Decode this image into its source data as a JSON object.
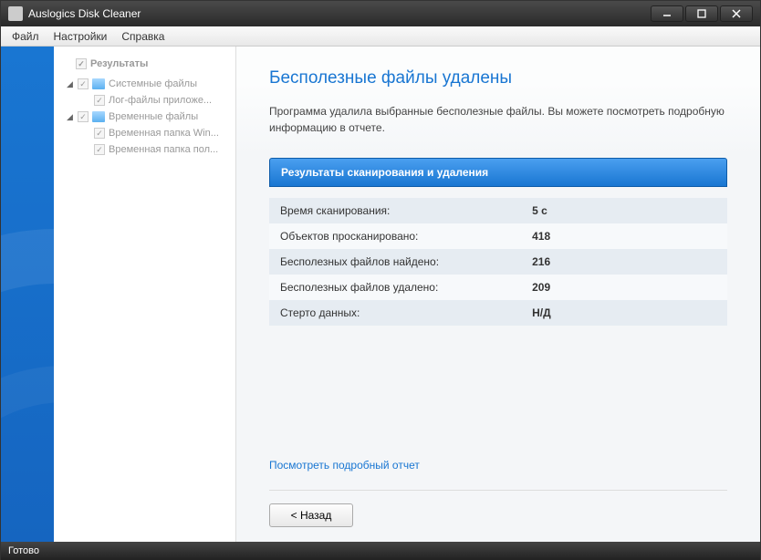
{
  "window": {
    "title": "Auslogics Disk Cleaner"
  },
  "menu": {
    "file": "Файл",
    "settings": "Настройки",
    "help": "Справка"
  },
  "tree": {
    "results": "Результаты",
    "system_files": "Системные файлы",
    "log_files": "Лог-файлы приложе...",
    "temp_files": "Временные файлы",
    "temp_win": "Временная папка Win...",
    "temp_user": "Временная папка пол..."
  },
  "content": {
    "heading": "Бесполезные файлы удалены",
    "description": "Программа удалила выбранные бесполезные файлы. Вы можете посмотреть подробную информацию в отчете.",
    "results_header": "Результаты сканирования и удаления",
    "rows": [
      {
        "label": "Время сканирования:",
        "value": "5 с"
      },
      {
        "label": "Объектов просканировано:",
        "value": "418"
      },
      {
        "label": "Бесполезных файлов найдено:",
        "value": "216"
      },
      {
        "label": "Бесполезных файлов удалено:",
        "value": "209"
      },
      {
        "label": "Стерто данных:",
        "value": "Н/Д"
      }
    ],
    "report_link": "Посмотреть подробный отчет",
    "back_button": "< Назад"
  },
  "status": "Готово"
}
